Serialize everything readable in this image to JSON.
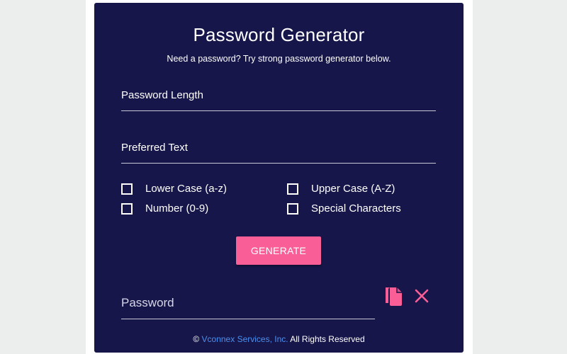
{
  "header": {
    "title": "Password Generator",
    "subtitle": "Need a password? Try strong password generator below."
  },
  "form": {
    "length_placeholder": "Password Length",
    "preferred_placeholder": "Preferred Text",
    "options": {
      "lower": {
        "label": "Lower Case (a-z)",
        "checked": false
      },
      "upper": {
        "label": "Upper Case (A-Z)",
        "checked": false
      },
      "number": {
        "label": "Number (0-9)",
        "checked": false
      },
      "special": {
        "label": "Special Characters",
        "checked": false
      }
    },
    "generate_label": "GENERATE"
  },
  "output": {
    "password_placeholder": "Password",
    "copy_icon": "copy-icon",
    "clear_icon": "close-icon"
  },
  "footer": {
    "copyright": "©",
    "company": "Vconnex Services, Inc.",
    "rights": "All Rights Reserved"
  },
  "colors": {
    "card_bg": "#16164a",
    "accent": "#f95f96",
    "link": "#4a90f0"
  }
}
